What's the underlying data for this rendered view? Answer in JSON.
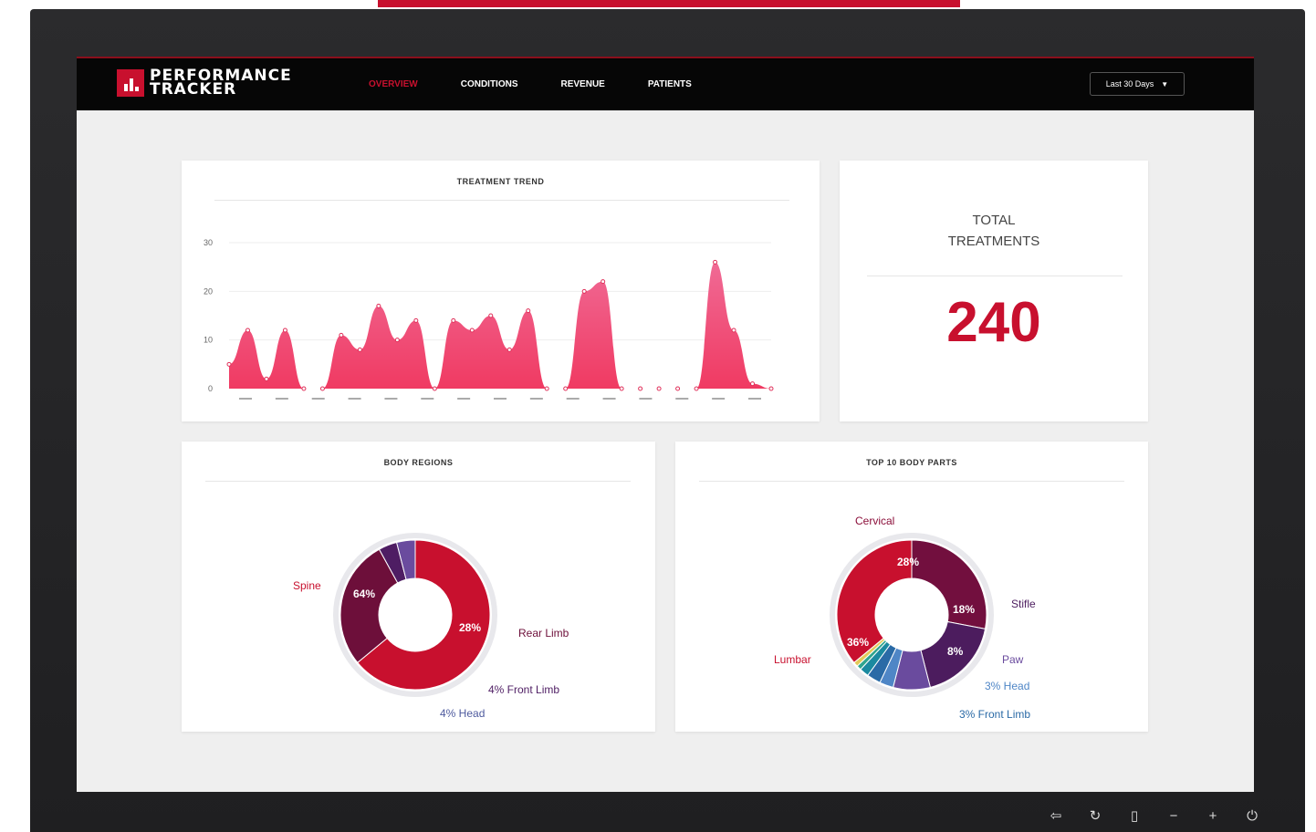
{
  "app": {
    "logo_line1": "PERFORMANCE",
    "logo_line2": "TRACKER",
    "brand_color": "#c8102e"
  },
  "nav": {
    "tabs": [
      {
        "label": "OVERVIEW",
        "active": true
      },
      {
        "label": "CONDITIONS",
        "active": false
      },
      {
        "label": "REVENUE",
        "active": false
      },
      {
        "label": "PATIENTS",
        "active": false
      }
    ],
    "range_label": "Last 30 Days"
  },
  "total": {
    "label_line1": "TOTAL",
    "label_line2": "TREATMENTS",
    "value": "240"
  },
  "chart_data": [
    {
      "type": "area",
      "title": "TREATMENT TREND",
      "ylim": [
        0,
        30
      ],
      "yticks": [
        0,
        10,
        20,
        30
      ],
      "x_tick_count": 15,
      "grid": true,
      "legend": "none",
      "color": "#f0457a",
      "values": [
        5,
        12,
        2,
        12,
        0,
        0,
        11,
        8,
        17,
        10,
        14,
        0,
        14,
        12,
        15,
        8,
        16,
        0,
        0,
        20,
        22,
        0,
        0,
        0,
        0,
        0,
        26,
        12,
        1,
        0
      ]
    },
    {
      "type": "pie",
      "title": "BODY REGIONS",
      "slices": [
        {
          "label": "Spine",
          "value": 64,
          "pct_label": "64%",
          "color": "#c8102e"
        },
        {
          "label": "Rear Limb",
          "value": 28,
          "pct_label": "28%",
          "color": "#6d0f3a"
        },
        {
          "label": "Front Limb",
          "value": 4,
          "pct_label": "4% Front Limb",
          "color": "#4e1d63"
        },
        {
          "label": "Head",
          "value": 4,
          "pct_label": "4% Head",
          "color": "#6a4b9e"
        }
      ]
    },
    {
      "type": "pie",
      "title": "TOP 10 BODY PARTS",
      "slices": [
        {
          "label": "Cervical",
          "value": 28,
          "pct_label": "28%",
          "color": "#720f3e"
        },
        {
          "label": "Stifle",
          "value": 18,
          "pct_label": "18%",
          "color": "#4c1c5e"
        },
        {
          "label": "Paw",
          "value": 8,
          "pct_label": "8%",
          "color": "#6a4b9e"
        },
        {
          "label": "Head",
          "value": 3,
          "pct_label": "3% Head",
          "color": "#4f86c6"
        },
        {
          "label": "Front Limb",
          "value": 3,
          "pct_label": "3% Front Limb",
          "color": "#2a6aa6"
        },
        {
          "label": "",
          "value": 2,
          "color": "#1b8aa0"
        },
        {
          "label": "",
          "value": 1,
          "color": "#2fa58e"
        },
        {
          "label": "",
          "value": 1,
          "color": "#e3c95a"
        },
        {
          "label": "Lumbar",
          "value": 36,
          "pct_label": "36%",
          "color": "#c8102e"
        }
      ]
    }
  ],
  "footer_icons": [
    "input-icon",
    "rotate-icon",
    "phone-icon",
    "minus-icon",
    "plus-icon",
    "power-icon"
  ]
}
